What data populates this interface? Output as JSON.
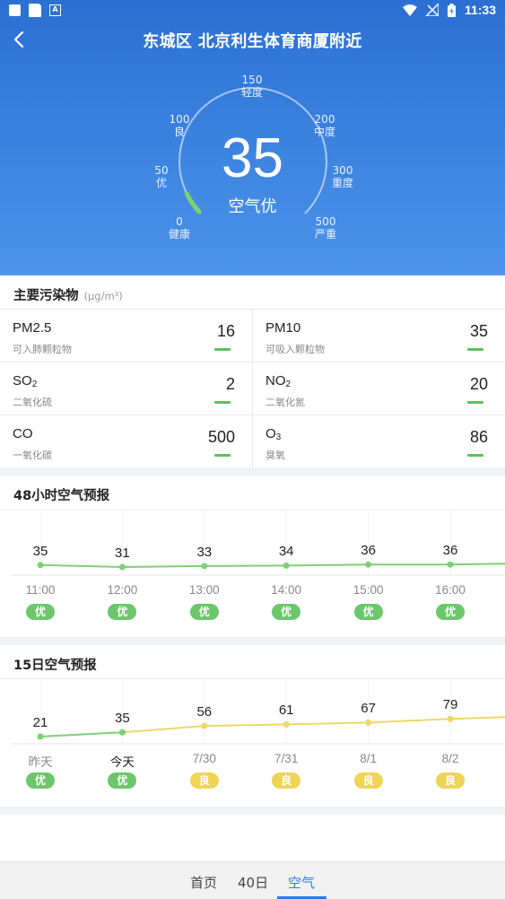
{
  "status_bar": {
    "time": "11:33"
  },
  "header": {
    "title": "东城区 北京利生体育商厦附近"
  },
  "gauge": {
    "aqi": "35",
    "aqi_label": "空气优",
    "level_fraction": 0.07,
    "ticks": [
      {
        "value": "0",
        "label": "健康"
      },
      {
        "value": "50",
        "label": "优"
      },
      {
        "value": "100",
        "label": "良"
      },
      {
        "value": "150",
        "label": "轻度"
      },
      {
        "value": "200",
        "label": "中度"
      },
      {
        "value": "300",
        "label": "重度"
      },
      {
        "value": "500",
        "label": "严重"
      }
    ]
  },
  "pollutants": {
    "title": "主要污染物",
    "unit": "(μg/m³)",
    "items": [
      {
        "name": "PM2.5",
        "sub": "",
        "desc": "可入肺颗粒物",
        "value": "16"
      },
      {
        "name": "PM10",
        "sub": "",
        "desc": "可吸入颗粒物",
        "value": "35"
      },
      {
        "name": "SO",
        "sub": "2",
        "desc": "二氧化硫",
        "value": "2"
      },
      {
        "name": "NO",
        "sub": "2",
        "desc": "二氧化氮",
        "value": "20"
      },
      {
        "name": "CO",
        "sub": "",
        "desc": "一氧化碳",
        "value": "500"
      },
      {
        "name": "O",
        "sub": "3",
        "desc": "臭氧",
        "value": "86"
      }
    ]
  },
  "forecast_48h": {
    "title": "48小时空气预报",
    "times": [
      "11:00",
      "12:00",
      "13:00",
      "14:00",
      "15:00",
      "16:00"
    ],
    "values": [
      35,
      31,
      33,
      34,
      36,
      36
    ],
    "levels": [
      "优",
      "优",
      "优",
      "优",
      "优",
      "优"
    ]
  },
  "forecast_15d": {
    "title": "15日空气预报",
    "days": [
      "昨天",
      "今天",
      "7/30",
      "7/31",
      "8/1",
      "8/2"
    ],
    "values": [
      21,
      35,
      56,
      61,
      67,
      79
    ],
    "levels": [
      "优",
      "优",
      "良",
      "良",
      "良",
      "良"
    ]
  },
  "colors": {
    "good": "#6cc76a",
    "moderate": "#f0d456",
    "line_good": "#7fcf75",
    "line_moderate": "#ecd96a",
    "accent": "#2f7be5"
  },
  "nav": {
    "items": [
      "首页",
      "40日",
      "空气"
    ],
    "active": "空气"
  }
}
